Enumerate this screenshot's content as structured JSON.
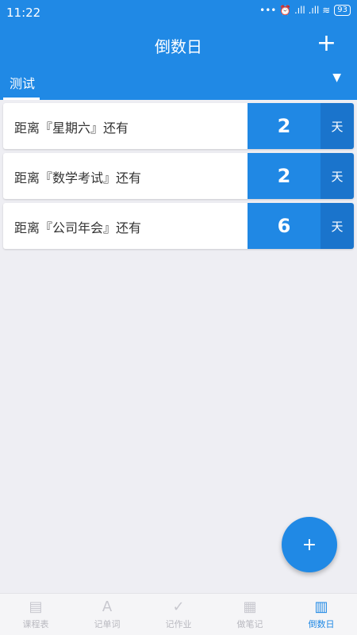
{
  "status": {
    "time": "11:22",
    "icons": "••• ⏰ .ıll .ıll ≋",
    "battery": "93"
  },
  "appbar": {
    "title": "倒数日",
    "add_icon": "+"
  },
  "tab": {
    "label": "测试",
    "dropdown_icon": "▼"
  },
  "items": [
    {
      "text": "距离『星期六』还有",
      "count": "2",
      "unit": "天"
    },
    {
      "text": "距离『数学考试』还有",
      "count": "2",
      "unit": "天"
    },
    {
      "text": "距离『公司年会』还有",
      "count": "6",
      "unit": "天"
    }
  ],
  "fab": {
    "icon": "+"
  },
  "nav": [
    {
      "label": "课程表",
      "icon": "▤"
    },
    {
      "label": "记单词",
      "icon": "A"
    },
    {
      "label": "记作业",
      "icon": "✓"
    },
    {
      "label": "做笔记",
      "icon": "▦"
    },
    {
      "label": "倒数日",
      "icon": "▥"
    }
  ]
}
